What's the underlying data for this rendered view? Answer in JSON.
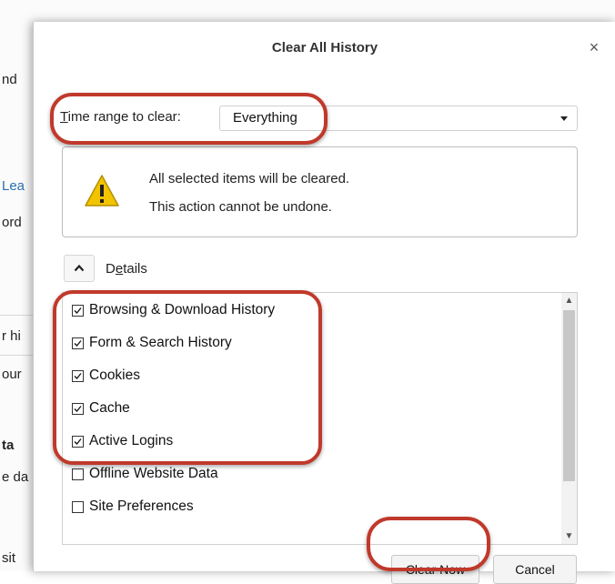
{
  "background": {
    "fragments": [
      "nd",
      "Lea",
      "ord",
      "r hi",
      "our",
      "ta",
      "e da",
      "sit"
    ]
  },
  "dialog": {
    "title": "Clear All History",
    "close_symbol": "×"
  },
  "time_range": {
    "label_underlined": "T",
    "label_rest": "ime range to clear:",
    "selected": "Everything"
  },
  "warning": {
    "line1": "All selected items will be cleared.",
    "line2": "This action cannot be undone.",
    "icon": "warning-triangle-icon"
  },
  "details": {
    "label_prefix": "D",
    "label_underlined": "e",
    "label_rest": "tails",
    "icon": "chevron-up-icon"
  },
  "items": [
    {
      "label": "Browsing & Download History",
      "checked": true
    },
    {
      "label": "Form & Search History",
      "checked": true
    },
    {
      "label": "Cookies",
      "checked": true
    },
    {
      "label": "Cache",
      "checked": true
    },
    {
      "label": "Active Logins",
      "checked": true
    },
    {
      "label": "Offline Website Data",
      "checked": false
    },
    {
      "label": "Site Preferences",
      "checked": false
    }
  ],
  "buttons": {
    "clear_now": "Clear Now",
    "cancel": "Cancel"
  },
  "colors": {
    "highlight": "#c0392b",
    "warning_yellow": "#f2c400"
  }
}
